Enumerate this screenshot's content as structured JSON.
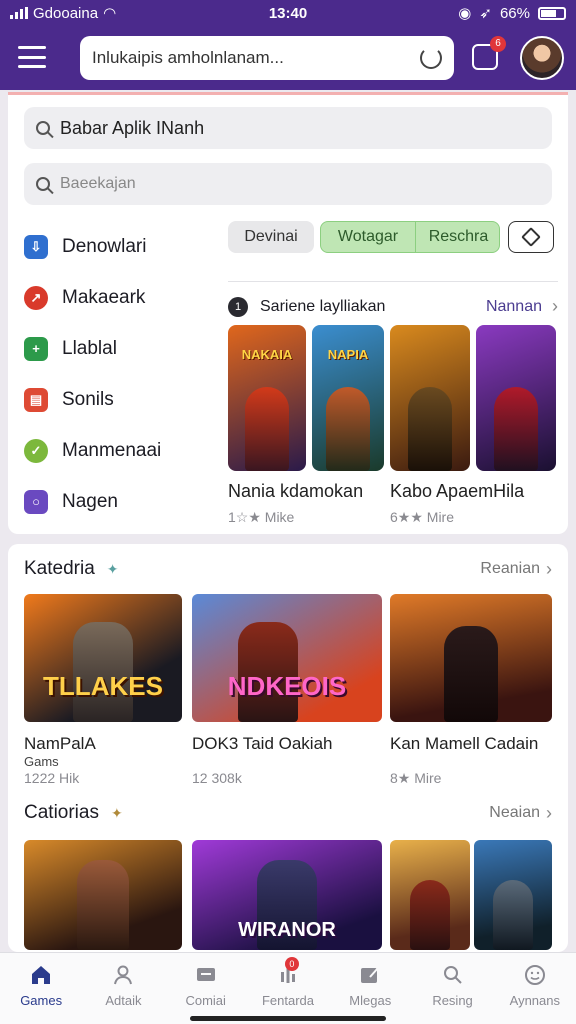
{
  "status": {
    "carrier": "Gdooaina",
    "time": "13:40",
    "battery": "66%"
  },
  "header": {
    "search_text": "Inlukaipis amholnlanam..."
  },
  "panel": {
    "search1": "Babar Aplik INanh",
    "search2": "Baeekajan",
    "categories": [
      {
        "label": "Denowlari",
        "icon": "download-icon",
        "color": "#2f6fcf"
      },
      {
        "label": "Makaeark",
        "icon": "chart-icon",
        "color": "#d93a2b"
      },
      {
        "label": "Llablal",
        "icon": "plus-icon",
        "color": "#2c9a4a"
      },
      {
        "label": "Sonils",
        "icon": "doc-icon",
        "color": "#de4a34"
      },
      {
        "label": "Manmenaai",
        "icon": "leaf-icon",
        "color": "#7cb83c"
      },
      {
        "label": "Nagen",
        "icon": "circle-icon",
        "color": "#6a49c0"
      }
    ],
    "chips": {
      "c1": "Devinai",
      "c2a": "Wotagar",
      "c2b": "Reschra"
    },
    "row": {
      "num": "1",
      "title": "Sariene laylliakan",
      "link": "Nannan"
    },
    "tiles": [
      {
        "label": "NAKAIA",
        "color1": "#e0671c",
        "color2": "#2a1a4a"
      },
      {
        "label": "NAPIA",
        "color1": "#3b8ed0",
        "color2": "#1a3a2a"
      },
      {
        "label": "",
        "color1": "#d98a1e",
        "color2": "#3a1a10"
      },
      {
        "label": "",
        "color1": "#8a3ac0",
        "color2": "#1a1030"
      }
    ],
    "game1": {
      "title": "Nania kdamokan",
      "meta": "1☆★ Mike"
    },
    "game2": {
      "title": "Kabo ApaemHila",
      "meta": "6★★ Mire"
    }
  },
  "section1": {
    "title": "Katedria",
    "more": "Reanian",
    "items": [
      {
        "label": "TLLAKES",
        "caption": "NamPalA",
        "sub": "Gams",
        "meta": "1222 Hik",
        "c1": "#f07a1c",
        "c2": "#1a1a22"
      },
      {
        "label": "NDKEOIS",
        "caption": "DOK3 Taid Oakiah",
        "sub": "",
        "meta": "12 308k",
        "c1": "#5a8ad8",
        "c2": "#d8431e"
      },
      {
        "label": "",
        "caption": "Kan Mamell Cadain",
        "sub": "",
        "meta": "8★ Mire",
        "c1": "#e07a28",
        "c2": "#3a1410"
      }
    ]
  },
  "section2": {
    "title": "Catiorias",
    "more": "Neaian",
    "items": [
      {
        "c1": "#d88a2a",
        "c2": "#2a1610"
      },
      {
        "label": "WIRANOR",
        "c1": "#a03ad8",
        "c2": "#1a1040"
      },
      {
        "c1": "#e8b04a",
        "c2": "#5a2a1a"
      },
      {
        "c1": "#3a78b8",
        "c2": "#10202a"
      }
    ]
  },
  "tabs": [
    {
      "label": "Games",
      "icon": "home-icon",
      "active": true
    },
    {
      "label": "Adtaik",
      "icon": "person-icon"
    },
    {
      "label": "Comiai",
      "icon": "message-icon"
    },
    {
      "label": "Fentarda",
      "icon": "chart-icon",
      "badge": "0"
    },
    {
      "label": "Mlegas",
      "icon": "edit-icon"
    },
    {
      "label": "Resing",
      "icon": "search-heart-icon"
    },
    {
      "label": "Aynnans",
      "icon": "smile-icon"
    }
  ]
}
